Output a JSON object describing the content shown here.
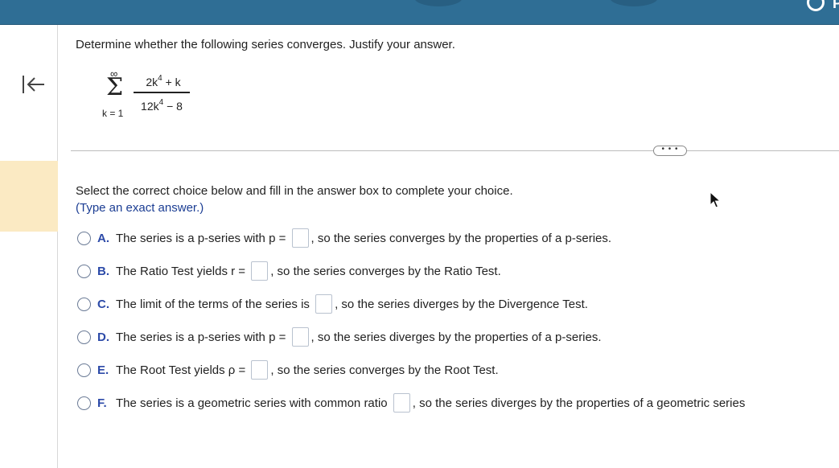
{
  "header": {
    "partial_label": "P"
  },
  "question": {
    "prompt": "Determine whether the following series converges. Justify your answer.",
    "series": {
      "upper_limit": "∞",
      "lower_limit": "k = 1",
      "numerator_a": "2k",
      "numerator_exp": "4",
      "numerator_b": " + k",
      "denominator_a": "12k",
      "denominator_exp": "4",
      "denominator_b": " − 8"
    }
  },
  "more_label": "• • •",
  "instructions": "Select the correct choice below and fill in the answer box to complete your choice.",
  "note": "(Type an exact answer.)",
  "choices": [
    {
      "letter": "A.",
      "before": "The series is a p-series with p = ",
      "after": ", so the series converges by the properties of a p-series."
    },
    {
      "letter": "B.",
      "before": "The Ratio Test yields r = ",
      "after": ", so the series converges by the Ratio Test."
    },
    {
      "letter": "C.",
      "before": "The limit of the terms of the series is ",
      "after": ", so the series diverges by the Divergence Test."
    },
    {
      "letter": "D.",
      "before": "The series is a p-series with p = ",
      "after": ", so the series diverges by the properties of a p-series."
    },
    {
      "letter": "E.",
      "before": "The Root Test yields ρ = ",
      "after": ", so the series converges by the Root Test."
    },
    {
      "letter": "F.",
      "before": "The series is a geometric series with common ratio ",
      "after": ", so the series diverges by the properties of a geometric series"
    }
  ],
  "colors": {
    "header_bar": "#2f6e95",
    "choice_letter": "#2c4aa8",
    "note_text": "#1b3d93",
    "highlight": "#fbeac3"
  }
}
